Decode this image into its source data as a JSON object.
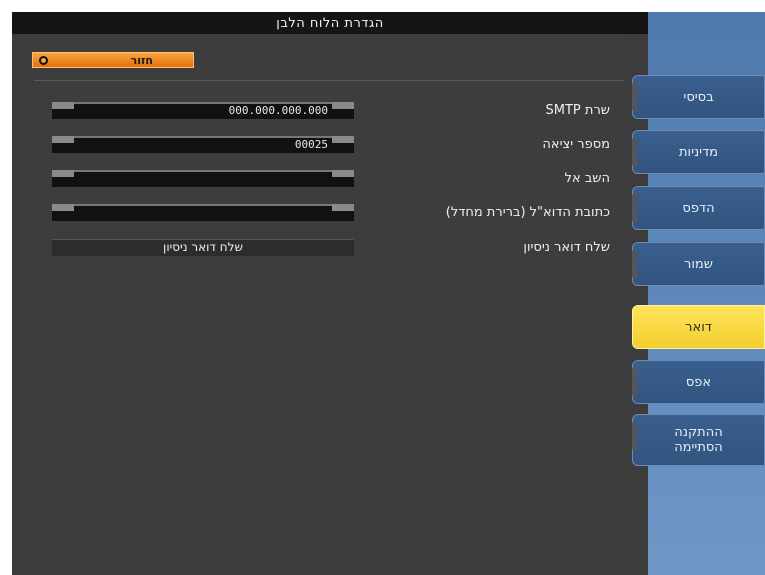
{
  "window": {
    "title": "הגדרת הלוח הלבן"
  },
  "back_button": {
    "label": "חזור",
    "icon": "back-arrow-icon"
  },
  "fields": [
    {
      "label": "שרת SMTP",
      "value": "000.000.000.000"
    },
    {
      "label": "מספר יציאה",
      "value": "00025"
    },
    {
      "label": "השב אל",
      "value": ""
    },
    {
      "label": "כתובת הדוא\"ל (ברירת מחדל)",
      "value": ""
    }
  ],
  "test_mail": {
    "label": "שלח דואר ניסיון",
    "button": "שלח דואר ניסיון"
  },
  "tabs": [
    {
      "label": "בסיסי"
    },
    {
      "label": "מדיניות"
    },
    {
      "label": "הדפס"
    },
    {
      "label": "שמור"
    },
    {
      "label": "דואר",
      "active": true
    },
    {
      "label": "אפס"
    },
    {
      "label": "ההתקנה הסתיימה"
    }
  ],
  "colors": {
    "accent_active_tab": "#f7d84a",
    "back_button": "#ee8a20",
    "sidebar": "#5b84b8"
  }
}
